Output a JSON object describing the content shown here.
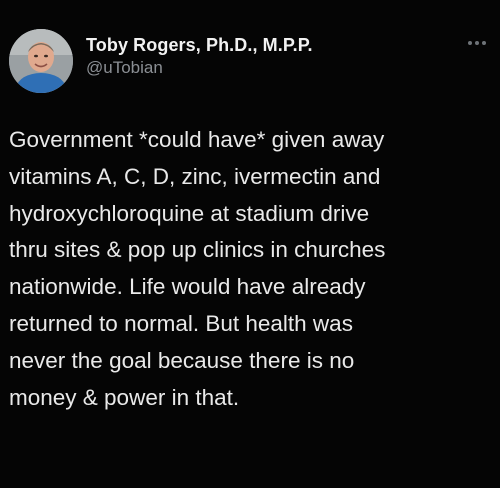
{
  "tweet": {
    "author": {
      "display_name": "Toby Rogers, Ph.D., M.P.P.",
      "handle": "@uTobian",
      "avatar_icon": "profile-photo"
    },
    "more_icon": "more-options-icon",
    "text": "Government *could have* given away\nvitamins A, C, D, zinc, ivermectin and\nhydroxychloroquine at stadium drive\nthru sites & pop up clinics in churches\nnationwide. Life would have already\nreturned to normal. But health was\nnever the goal because there is no\nmoney & power in that."
  },
  "colors": {
    "background": "#050505",
    "primary_text": "#e9e9e9",
    "secondary_text": "#8b8f94"
  }
}
